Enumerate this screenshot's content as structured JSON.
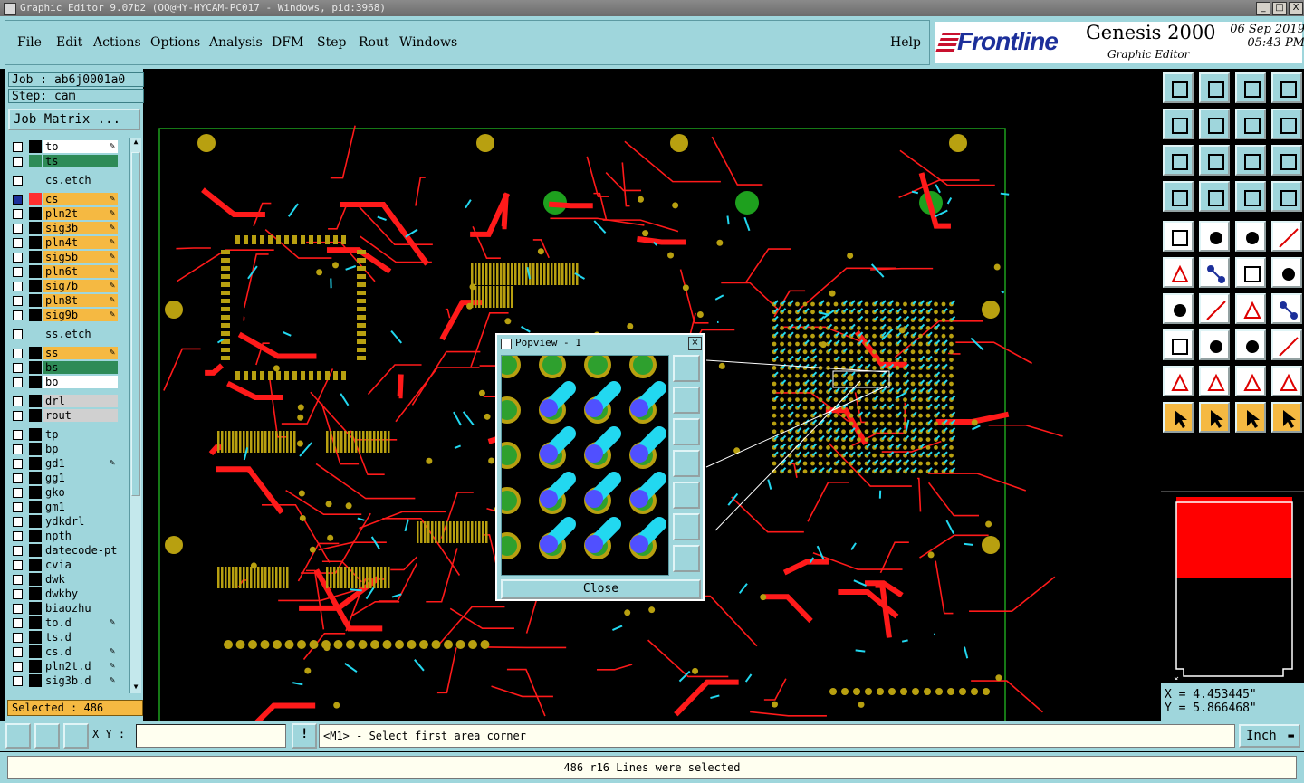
{
  "window": {
    "title": "Graphic Editor 9.07b2 (OO@HY-HYCAM-PC017 - Windows, pid:3968)",
    "minimize": "_",
    "maximize": "□",
    "close": "X"
  },
  "menu": {
    "items": [
      "File",
      "Edit",
      "Actions",
      "Options",
      "Analysis",
      "DFM",
      "Step",
      "Rout",
      "Windows"
    ],
    "help": "Help"
  },
  "brand": {
    "logo": "Frontline",
    "product": "Genesis 2000",
    "subtitle": "Graphic Editor",
    "date": "06 Sep 2019",
    "time": "05:43 PM"
  },
  "job": {
    "job": "Job : ab6j0001a0",
    "step": "Step: cam",
    "matrix_button": "Job Matrix ..."
  },
  "layers": [
    {
      "name": "to",
      "bg": "#ffffff",
      "edit": "✎",
      "color": "#000000"
    },
    {
      "name": "ts",
      "bg": "#2e8b57",
      "edit": "",
      "color": "#2e8b57"
    },
    {
      "name": "cs.etch",
      "bg": "#9fd6dc",
      "edit": "",
      "color": "#9fd6dc"
    },
    {
      "name": "cs",
      "bg": "#f5b942",
      "edit": "✎",
      "color": "#ff3030",
      "active": true
    },
    {
      "name": "pln2t",
      "bg": "#f5b942",
      "edit": "✎",
      "color": "#000000"
    },
    {
      "name": "sig3b",
      "bg": "#f5b942",
      "edit": "✎",
      "color": "#000000"
    },
    {
      "name": "pln4t",
      "bg": "#f5b942",
      "edit": "✎",
      "color": "#000000"
    },
    {
      "name": "sig5b",
      "bg": "#f5b942",
      "edit": "✎",
      "color": "#000000"
    },
    {
      "name": "pln6t",
      "bg": "#f5b942",
      "edit": "✎",
      "color": "#000000"
    },
    {
      "name": "sig7b",
      "bg": "#f5b942",
      "edit": "✎",
      "color": "#000000"
    },
    {
      "name": "pln8t",
      "bg": "#f5b942",
      "edit": "✎",
      "color": "#000000"
    },
    {
      "name": "sig9b",
      "bg": "#f5b942",
      "edit": "✎",
      "color": "#000000"
    },
    {
      "name": "ss.etch",
      "bg": "#9fd6dc",
      "edit": "",
      "color": "#9fd6dc"
    },
    {
      "name": "ss",
      "bg": "#f5b942",
      "edit": "✎",
      "color": "#000000"
    },
    {
      "name": "bs",
      "bg": "#2e8b57",
      "edit": "",
      "color": "#000000"
    },
    {
      "name": "bo",
      "bg": "#ffffff",
      "edit": "",
      "color": "#000000"
    },
    {
      "name": "drl",
      "bg": "#d0d0d0",
      "edit": "",
      "color": "#000000"
    },
    {
      "name": "rout",
      "bg": "#d0d0d0",
      "edit": "",
      "color": "#000000"
    },
    {
      "name": "tp",
      "bg": "#9fd6dc",
      "edit": "",
      "color": "#000000"
    },
    {
      "name": "bp",
      "bg": "#9fd6dc",
      "edit": "",
      "color": "#000000"
    },
    {
      "name": "gd1",
      "bg": "#9fd6dc",
      "edit": "✎",
      "color": "#000000"
    },
    {
      "name": "gg1",
      "bg": "#9fd6dc",
      "edit": "",
      "color": "#000000"
    },
    {
      "name": "gko",
      "bg": "#9fd6dc",
      "edit": "",
      "color": "#000000"
    },
    {
      "name": "gm1",
      "bg": "#9fd6dc",
      "edit": "",
      "color": "#000000"
    },
    {
      "name": "ydkdrl",
      "bg": "#9fd6dc",
      "edit": "",
      "color": "#000000"
    },
    {
      "name": "npth",
      "bg": "#9fd6dc",
      "edit": "",
      "color": "#000000"
    },
    {
      "name": "datecode-pth",
      "bg": "#9fd6dc",
      "edit": "",
      "color": "#000000"
    },
    {
      "name": "cvia",
      "bg": "#9fd6dc",
      "edit": "",
      "color": "#000000"
    },
    {
      "name": "dwk",
      "bg": "#9fd6dc",
      "edit": "",
      "color": "#000000"
    },
    {
      "name": "dwkby",
      "bg": "#9fd6dc",
      "edit": "",
      "color": "#000000"
    },
    {
      "name": "biaozhu",
      "bg": "#9fd6dc",
      "edit": "",
      "color": "#000000"
    },
    {
      "name": "to.d",
      "bg": "#9fd6dc",
      "edit": "✎",
      "color": "#000000"
    },
    {
      "name": "ts.d",
      "bg": "#9fd6dc",
      "edit": "",
      "color": "#000000"
    },
    {
      "name": "cs.d",
      "bg": "#9fd6dc",
      "edit": "✎",
      "color": "#000000"
    },
    {
      "name": "pln2t.d",
      "bg": "#9fd6dc",
      "edit": "✎",
      "color": "#000000"
    },
    {
      "name": "sig3b.d",
      "bg": "#9fd6dc",
      "edit": "✎",
      "color": "#000000"
    }
  ],
  "selected": "Selected : 486",
  "popview": {
    "title": "Popview - 1",
    "close_label": "Close"
  },
  "coords": {
    "x": "X = 4.453445\"",
    "y": "Y = 5.866468\""
  },
  "bottom": {
    "xy_label": "X Y :",
    "xy_value": "",
    "prompt": "<M1> - Select first area corner",
    "unit": "Inch",
    "status": "486 r16 Lines were selected"
  },
  "colors": {
    "trace": "#ff1a1a",
    "pad": "#b8a010",
    "selected": "#22d8f0",
    "fiducial": "#1ea01e",
    "panel": "#9fd6dc"
  }
}
